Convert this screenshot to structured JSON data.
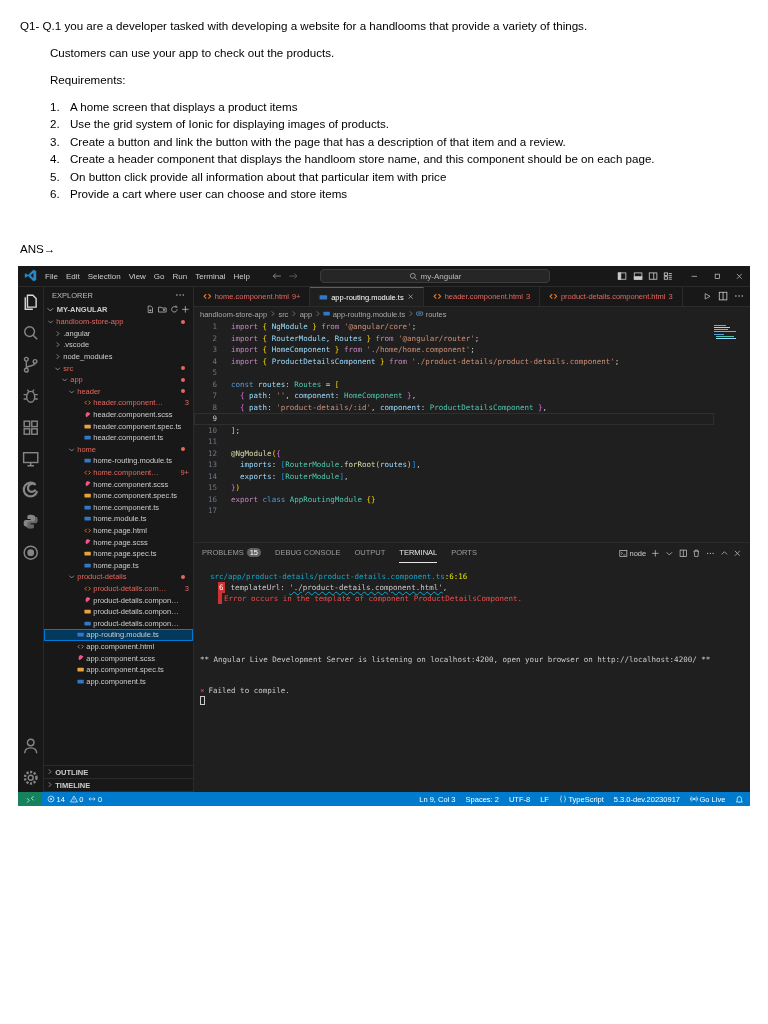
{
  "question": "Q1- Q.1 you are a developer tasked with developing a website for a handlooms that provide a variety of things.",
  "intro": "Customers can use your app to check out the products.",
  "requirements_heading": "Requirements:",
  "requirements": [
    {
      "number": "1.",
      "text": "A home screen that displays a product items"
    },
    {
      "number": "2.",
      "text": "Use the grid system of Ionic for displaying images of products."
    },
    {
      "number": "3.",
      "text": "Create a button and link the button with the page that has a description of that item and a review."
    },
    {
      "number": "4.",
      "text": "Create a header component that displays the handloom store name, and this component should be on each page."
    },
    {
      "number": "5.",
      "text": "On button click provide all information about that particular item with price"
    },
    {
      "number": "6.",
      "text": "Provide a cart where user can choose and store items"
    }
  ],
  "answer_label": "ANS→",
  "vscode": {
    "menu": [
      "File",
      "Edit",
      "Selection",
      "View",
      "Go",
      "Run",
      "Terminal",
      "Help"
    ],
    "command_center": {
      "value": "my-Angular"
    },
    "explorer": {
      "title": "EXPLORER",
      "workspace": "MY-ANGULAR",
      "tree": [
        {
          "label": "handloom-store-app",
          "kind": "folder",
          "error": true,
          "selected": false,
          "expanded": true,
          "children": [
            {
              "label": ".angular",
              "kind": "folder",
              "error": false,
              "selected": false,
              "expanded": false
            },
            {
              "label": ".vscode",
              "kind": "folder",
              "error": false,
              "selected": false,
              "expanded": false
            },
            {
              "label": "node_modules",
              "kind": "folder",
              "error": false,
              "selected": false,
              "expanded": false
            },
            {
              "label": "src",
              "kind": "folder",
              "error": true,
              "selected": false,
              "expanded": true,
              "children": [
                {
                  "label": "app",
                  "kind": "folder",
                  "error": true,
                  "selected": false,
                  "expanded": true,
                  "children": [
                    {
                      "label": "header",
                      "kind": "folder",
                      "error": true,
                      "selected": false,
                      "expanded": true,
                      "children": [
                        {
                          "label": "header.component…",
                          "kind": "html",
                          "error": true,
                          "badge": "3",
                          "selected": false
                        },
                        {
                          "label": "header.component.scss",
                          "kind": "scss",
                          "error": false,
                          "selected": false
                        },
                        {
                          "label": "header.component.spec.ts",
                          "kind": "spec",
                          "error": false,
                          "selected": false
                        },
                        {
                          "label": "header.component.ts",
                          "kind": "ts",
                          "error": false,
                          "selected": false
                        }
                      ]
                    },
                    {
                      "label": "home",
                      "kind": "folder",
                      "error": true,
                      "selected": false,
                      "expanded": true,
                      "children": [
                        {
                          "label": "home-routing.module.ts",
                          "kind": "ts",
                          "error": false,
                          "selected": false
                        },
                        {
                          "label": "home.component…",
                          "kind": "html",
                          "error": true,
                          "badge": "9+",
                          "selected": false
                        },
                        {
                          "label": "home.component.scss",
                          "kind": "scss",
                          "error": false,
                          "selected": false
                        },
                        {
                          "label": "home.component.spec.ts",
                          "kind": "spec",
                          "error": false,
                          "selected": false
                        },
                        {
                          "label": "home.component.ts",
                          "kind": "ts",
                          "error": false,
                          "selected": false
                        },
                        {
                          "label": "home.module.ts",
                          "kind": "ts",
                          "error": false,
                          "selected": false
                        },
                        {
                          "label": "home.page.html",
                          "kind": "html",
                          "error": false,
                          "selected": false
                        },
                        {
                          "label": "home.page.scss",
                          "kind": "scss",
                          "error": false,
                          "selected": false
                        },
                        {
                          "label": "home.page.spec.ts",
                          "kind": "spec",
                          "error": false,
                          "selected": false
                        },
                        {
                          "label": "home.page.ts",
                          "kind": "ts",
                          "error": false,
                          "selected": false
                        }
                      ]
                    },
                    {
                      "label": "product-details",
                      "kind": "folder",
                      "error": true,
                      "selected": false,
                      "expanded": true,
                      "children": [
                        {
                          "label": "product-details.com…",
                          "kind": "html",
                          "error": true,
                          "badge": "3",
                          "selected": false
                        },
                        {
                          "label": "product-details.compon…",
                          "kind": "scss",
                          "error": false,
                          "selected": false
                        },
                        {
                          "label": "product-details.compon…",
                          "kind": "spec",
                          "error": false,
                          "selected": false
                        },
                        {
                          "label": "product-details.compon…",
                          "kind": "ts",
                          "error": false,
                          "selected": false
                        }
                      ]
                    },
                    {
                      "label": "app-routing.module.ts",
                      "kind": "ts",
                      "error": false,
                      "selected": true
                    },
                    {
                      "label": "app.component.html",
                      "kind": "html",
                      "error": false,
                      "selected": false
                    },
                    {
                      "label": "app.component.scss",
                      "kind": "scss",
                      "error": false,
                      "selected": false
                    },
                    {
                      "label": "app.component.spec.ts",
                      "kind": "spec",
                      "error": false,
                      "selected": false
                    },
                    {
                      "label": "app.component.ts",
                      "kind": "ts",
                      "error": false,
                      "selected": false
                    }
                  ]
                }
              ]
            }
          ]
        }
      ],
      "sections": [
        {
          "label": "OUTLINE",
          "expanded": false
        },
        {
          "label": "TIMELINE",
          "expanded": false
        }
      ]
    },
    "tabs": [
      {
        "label": "home.component.html",
        "kind": "html",
        "error": true,
        "badge": "9+",
        "selected": false
      },
      {
        "label": "app-routing.module.ts",
        "kind": "ts",
        "error": false,
        "selected": true
      },
      {
        "label": "header.component.html",
        "kind": "html",
        "error": true,
        "badge": "3",
        "selected": false
      },
      {
        "label": "product-details.component.html",
        "kind": "html",
        "error": true,
        "badge": "3",
        "selected": false
      }
    ],
    "breadcrumb": [
      {
        "label": "handloom-store-app",
        "kind": "folder"
      },
      {
        "label": "src",
        "kind": "folder"
      },
      {
        "label": "app",
        "kind": "folder"
      },
      {
        "label": "app-routing.module.ts",
        "kind": "ts"
      },
      {
        "label": "routes",
        "kind": "symbol"
      }
    ],
    "code": [
      {
        "number": "1",
        "current": false,
        "tokens": [
          {
            "text": "import",
            "kind": "keyword"
          },
          {
            "text": " {",
            "kind": "bracket1"
          },
          {
            "text": " NgModule",
            "kind": "variable"
          },
          {
            "text": " }",
            "kind": "bracket1"
          },
          {
            "text": " from",
            "kind": "keyword"
          },
          {
            "text": " '@angular/core'",
            "kind": "string"
          },
          {
            "text": ";",
            "kind": "punctuation"
          }
        ]
      },
      {
        "number": "2",
        "current": false,
        "tokens": [
          {
            "text": "import",
            "kind": "keyword"
          },
          {
            "text": " {",
            "kind": "bracket1"
          },
          {
            "text": " RouterModule",
            "kind": "variable"
          },
          {
            "text": ",",
            "kind": "punctuation"
          },
          {
            "text": " Routes",
            "kind": "variable"
          },
          {
            "text": " }",
            "kind": "bracket1"
          },
          {
            "text": " from",
            "kind": "keyword"
          },
          {
            "text": " '@angular/router'",
            "kind": "string"
          },
          {
            "text": ";",
            "kind": "punctuation"
          }
        ]
      },
      {
        "number": "3",
        "current": false,
        "tokens": [
          {
            "text": "import",
            "kind": "keyword"
          },
          {
            "text": " {",
            "kind": "bracket1"
          },
          {
            "text": " HomeComponent",
            "kind": "variable"
          },
          {
            "text": " }",
            "kind": "bracket1"
          },
          {
            "text": " from",
            "kind": "keyword"
          },
          {
            "text": " './home/home.component'",
            "kind": "string"
          },
          {
            "text": ";",
            "kind": "punctuation"
          }
        ]
      },
      {
        "number": "4",
        "current": false,
        "tokens": [
          {
            "text": "import",
            "kind": "keyword"
          },
          {
            "text": " {",
            "kind": "bracket1"
          },
          {
            "text": " ProductDetailsComponent",
            "kind": "variable"
          },
          {
            "text": " }",
            "kind": "bracket1"
          },
          {
            "text": " from",
            "kind": "keyword"
          },
          {
            "text": " './product-details/product-details.component'",
            "kind": "string"
          },
          {
            "text": ";",
            "kind": "punctuation"
          }
        ]
      },
      {
        "number": "5",
        "current": false
      },
      {
        "number": "6",
        "current": false,
        "tokens": [
          {
            "text": "const",
            "kind": "storage"
          },
          {
            "text": " routes",
            "kind": "variable"
          },
          {
            "text": ":",
            "kind": "punctuation"
          },
          {
            "text": " Routes",
            "kind": "type"
          },
          {
            "text": " =",
            "kind": "punctuation"
          },
          {
            "text": " [",
            "kind": "bracket1"
          }
        ]
      },
      {
        "number": "7",
        "current": false,
        "tokens": [
          {
            "text": "  {",
            "kind": "bracket2"
          },
          {
            "text": " path",
            "kind": "variable"
          },
          {
            "text": ":",
            "kind": "punctuation"
          },
          {
            "text": " ''",
            "kind": "string"
          },
          {
            "text": ",",
            "kind": "punctuation"
          },
          {
            "text": " component",
            "kind": "variable"
          },
          {
            "text": ":",
            "kind": "punctuation"
          },
          {
            "text": " HomeComponent",
            "kind": "type"
          },
          {
            "text": " }",
            "kind": "bracket2"
          },
          {
            "text": ",",
            "kind": "punctuation"
          }
        ]
      },
      {
        "number": "8",
        "current": false,
        "tokens": [
          {
            "text": "  {",
            "kind": "bracket2"
          },
          {
            "text": " path",
            "kind": "variable"
          },
          {
            "text": ":",
            "kind": "punctuation"
          },
          {
            "text": " 'product-details/:id'",
            "kind": "string"
          },
          {
            "text": ",",
            "kind": "punctuation"
          },
          {
            "text": " component",
            "kind": "variable"
          },
          {
            "text": ":",
            "kind": "punctuation"
          },
          {
            "text": " ProductDetailsComponent",
            "kind": "type"
          },
          {
            "text": " }",
            "kind": "bracket2"
          },
          {
            "text": ",",
            "kind": "punctuation"
          }
        ]
      },
      {
        "number": "9",
        "current": true
      },
      {
        "number": "10",
        "current": false,
        "tokens": [
          {
            "text": "]",
            "kind": "bracket1"
          },
          {
            "text": ";",
            "kind": "punctuation"
          }
        ]
      },
      {
        "number": "11",
        "current": false
      },
      {
        "number": "12",
        "current": false,
        "tokens": [
          {
            "text": "@NgModule",
            "kind": "function"
          },
          {
            "text": "(",
            "kind": "bracket1"
          },
          {
            "text": "{",
            "kind": "bracket2"
          }
        ]
      },
      {
        "number": "13",
        "current": false,
        "tokens": [
          {
            "text": "  imports",
            "kind": "variable"
          },
          {
            "text": ":",
            "kind": "punctuation"
          },
          {
            "text": " [",
            "kind": "bracket3"
          },
          {
            "text": "RouterModule",
            "kind": "type"
          },
          {
            "text": ".",
            "kind": "punctuation"
          },
          {
            "text": "forRoot",
            "kind": "function"
          },
          {
            "text": "(",
            "kind": "bracket1"
          },
          {
            "text": "routes",
            "kind": "variable"
          },
          {
            "text": ")",
            "kind": "bracket1"
          },
          {
            "text": "]",
            "kind": "bracket3"
          },
          {
            "text": ",",
            "kind": "punctuation"
          }
        ]
      },
      {
        "number": "14",
        "current": false,
        "tokens": [
          {
            "text": "  exports",
            "kind": "variable"
          },
          {
            "text": ":",
            "kind": "punctuation"
          },
          {
            "text": " [",
            "kind": "bracket3"
          },
          {
            "text": "RouterModule",
            "kind": "type"
          },
          {
            "text": "]",
            "kind": "bracket3"
          },
          {
            "text": ",",
            "kind": "punctuation"
          }
        ]
      },
      {
        "number": "15",
        "current": false,
        "tokens": [
          {
            "text": "}",
            "kind": "bracket2"
          },
          {
            "text": ")",
            "kind": "bracket1"
          }
        ]
      },
      {
        "number": "16",
        "current": false,
        "tokens": [
          {
            "text": "export",
            "kind": "keyword"
          },
          {
            "text": " class",
            "kind": "storage"
          },
          {
            "text": " AppRoutingModule",
            "kind": "type"
          },
          {
            "text": " {",
            "kind": "bracket1"
          },
          {
            "text": "}",
            "kind": "bracket1"
          }
        ]
      },
      {
        "number": "17",
        "current": false
      }
    ],
    "panel": {
      "tabs": [
        {
          "label": "PROBLEMS",
          "badge": "15",
          "selected": false
        },
        {
          "label": "DEBUG CONSOLE",
          "selected": false
        },
        {
          "label": "OUTPUT",
          "selected": false
        },
        {
          "label": "TERMINAL",
          "selected": true
        },
        {
          "label": "PORTS",
          "selected": false
        }
      ],
      "shell": "node",
      "lines": [
        {
          "kind": "location",
          "tokens": [
            {
              "text": "src/app/product-details/product-details.component.ts",
              "kind": "path"
            },
            {
              "text": ":6:16",
              "kind": "position"
            }
          ]
        },
        {
          "kind": "source",
          "gutter": "6",
          "tokens": [
            {
              "text": "templateUrl: ",
              "kind": "plain"
            },
            {
              "text": "'./product-details.component.html'",
              "kind": "squiggle"
            },
            {
              "text": ",",
              "kind": "plain"
            }
          ]
        },
        {
          "kind": "error",
          "tokens": [
            {
              "text": "Error occurs in the template of component ProductDetailsComponent.",
              "kind": "error"
            }
          ]
        },
        {
          "kind": "info",
          "tokens": [
            {
              "text": "** Angular Live Development Server is listening on localhost:4200, open your browser on http://localhost:4200/ **",
              "kind": "plain"
            }
          ]
        },
        {
          "kind": "failure",
          "marker": "×",
          "tokens": [
            {
              "text": "Failed to compile.",
              "kind": "plain"
            }
          ]
        },
        {
          "kind": "cursor"
        }
      ]
    },
    "status_bar": {
      "left": [
        {
          "kind": "remote"
        },
        {
          "kind": "errors",
          "text": "14"
        },
        {
          "kind": "warnings",
          "text": "0"
        },
        {
          "kind": "ports",
          "text": "0"
        }
      ],
      "right": [
        {
          "kind": "text",
          "text": "Ln 9, Col 3"
        },
        {
          "kind": "text",
          "text": "Spaces: 2"
        },
        {
          "kind": "text",
          "text": "UTF-8"
        },
        {
          "kind": "text",
          "text": "LF"
        },
        {
          "kind": "language",
          "text": "TypeScript"
        },
        {
          "kind": "text",
          "text": "5.3.0-dev.20230917"
        },
        {
          "kind": "live",
          "text": "Go Live"
        },
        {
          "kind": "bell"
        }
      ]
    }
  }
}
